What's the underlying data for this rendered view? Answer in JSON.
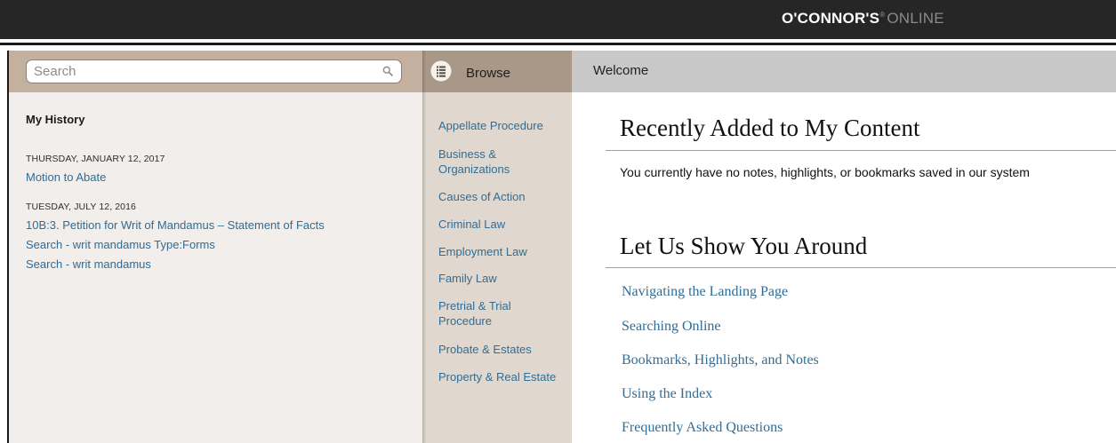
{
  "brand": {
    "name": "O'CONNOR'S",
    "trademark": "®",
    "suffix": "ONLINE"
  },
  "search": {
    "placeholder": "Search",
    "icon": "search-icon"
  },
  "history": {
    "title": "My History",
    "groups": [
      {
        "date": "THURSDAY, JANUARY 12, 2017",
        "items": [
          "Motion to Abate"
        ]
      },
      {
        "date": "TUESDAY, JULY 12, 2016",
        "items": [
          "10B:3. Petition for Writ of Mandamus – Statement of Facts",
          "Search - writ mandamus Type:Forms",
          "Search - writ mandamus"
        ]
      }
    ]
  },
  "browse": {
    "label": "Browse",
    "icon": "list-icon",
    "categories": [
      "Appellate Procedure",
      "Business & Organizations",
      "Causes of Action",
      "Criminal Law",
      "Employment Law",
      "Family Law",
      "Pretrial & Trial Procedure",
      "Probate & Estates",
      "Property & Real Estate"
    ]
  },
  "main": {
    "tab_label": "Welcome",
    "recent": {
      "title": "Recently Added to My Content",
      "empty_message": "You currently have no notes, highlights, or bookmarks saved in our system"
    },
    "tour": {
      "title": "Let Us Show You Around",
      "links": [
        "Navigating the Landing Page",
        "Searching Online",
        "Bookmarks, Highlights, and Notes",
        "Using the Index",
        "Frequently Asked Questions"
      ]
    }
  },
  "colors": {
    "link": "#2f6d97",
    "topbar": "#262626",
    "left_header": "#c3b09f",
    "left_panel": "#f1eeeb",
    "browse_header": "#a99888",
    "browse_panel": "#e0d8cf",
    "main_header": "#c8c8c8"
  }
}
